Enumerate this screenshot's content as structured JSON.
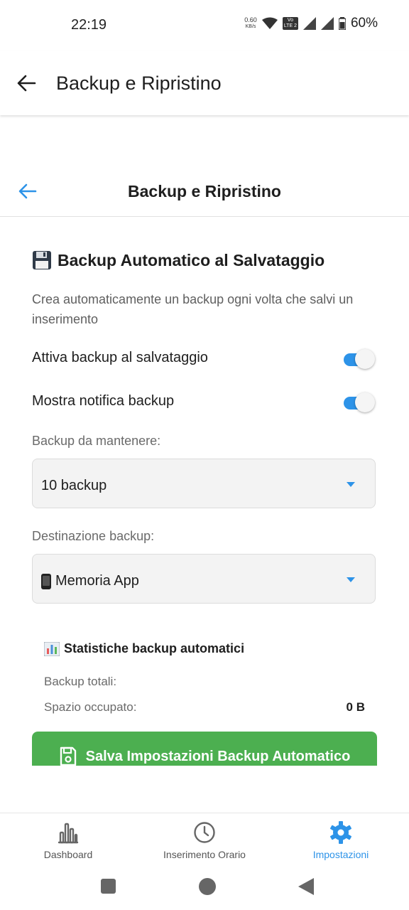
{
  "status_bar": {
    "time": "22:19",
    "net_speed_value": "0.60",
    "net_speed_unit": "KB/s",
    "lte_top": "Vo",
    "lte_bottom": "LTE 2",
    "battery": "60%"
  },
  "app_bar": {
    "title": "Backup e Ripristino"
  },
  "inner_header": {
    "title": "Backup e Ripristino"
  },
  "auto_backup": {
    "section_title": "Backup Automatico al Salvataggio",
    "description": "Crea automaticamente un backup ogni volta che salvi un inserimento",
    "toggle_save_label": "Attiva backup al salvataggio",
    "toggle_save_on": true,
    "toggle_notify_label": "Mostra notifica backup",
    "toggle_notify_on": true,
    "keep_label": "Backup da mantenere:",
    "keep_value": "10 backup",
    "destination_label": "Destinazione backup:",
    "destination_value": "Memoria App"
  },
  "stats": {
    "title": "Statistiche backup automatici",
    "total_label": "Backup totali:",
    "total_value": "",
    "space_label": "Spazio occupato:",
    "space_value": "0 B"
  },
  "save_button": {
    "label": "Salva Impostazioni Backup Automatico"
  },
  "bottom_nav": {
    "items": [
      {
        "label": "Dashboard",
        "icon": "bar-chart-icon",
        "active": false
      },
      {
        "label": "Inserimento Orario",
        "icon": "clock-icon",
        "active": false
      },
      {
        "label": "Impostazioni",
        "icon": "gear-icon",
        "active": true
      }
    ]
  },
  "colors": {
    "accent": "#2d93e8",
    "save_button": "#4caf50"
  }
}
